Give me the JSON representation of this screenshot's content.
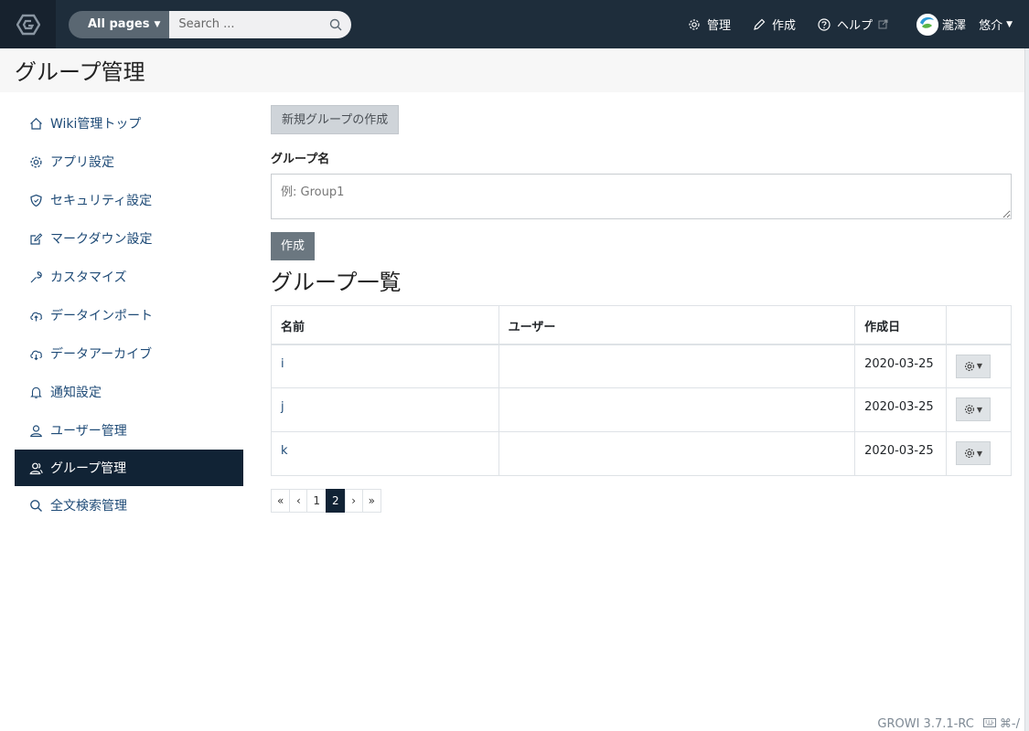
{
  "navbar": {
    "search_scope": "All pages",
    "search_placeholder": "Search ...",
    "links": {
      "admin": "管理",
      "create": "作成",
      "help": "ヘルプ"
    },
    "user": {
      "last_name": "瀧澤",
      "first_name": "悠介"
    }
  },
  "page": {
    "title": "グループ管理"
  },
  "sidebar": {
    "items": [
      {
        "label": "Wiki管理トップ",
        "icon": "home-icon"
      },
      {
        "label": "アプリ設定",
        "icon": "gear-icon"
      },
      {
        "label": "セキュリティ設定",
        "icon": "shield-icon"
      },
      {
        "label": "マークダウン設定",
        "icon": "edit-icon"
      },
      {
        "label": "カスタマイズ",
        "icon": "wrench-icon"
      },
      {
        "label": "データインポート",
        "icon": "cloud-upload-icon"
      },
      {
        "label": "データアーカイブ",
        "icon": "cloud-download-icon"
      },
      {
        "label": "通知設定",
        "icon": "bell-icon"
      },
      {
        "label": "ユーザー管理",
        "icon": "user-icon"
      },
      {
        "label": "グループ管理",
        "icon": "users-icon",
        "active": true
      },
      {
        "label": "全文検索管理",
        "icon": "search-icon"
      }
    ]
  },
  "main": {
    "new_group_button": "新規グループの作成",
    "group_name_label": "グループ名",
    "group_name_placeholder": "例: Group1",
    "create_button": "作成",
    "list_title": "グループ一覧",
    "table": {
      "headers": [
        "名前",
        "ユーザー",
        "作成日",
        ""
      ],
      "rows": [
        {
          "name": "i",
          "users": "",
          "created": "2020-03-25"
        },
        {
          "name": "j",
          "users": "",
          "created": "2020-03-25"
        },
        {
          "name": "k",
          "users": "",
          "created": "2020-03-25"
        }
      ]
    },
    "pagination": {
      "first": "«",
      "prev": "‹",
      "pages": [
        "1",
        "2"
      ],
      "active_page": "2",
      "next": "›",
      "last": "»"
    }
  },
  "footer": {
    "version": "GROWI 3.7.1-RC",
    "shortcut": "⌘-/"
  },
  "colors": {
    "navbar": "#1e2d3b",
    "active": "#112335",
    "link": "#1f4b77"
  }
}
